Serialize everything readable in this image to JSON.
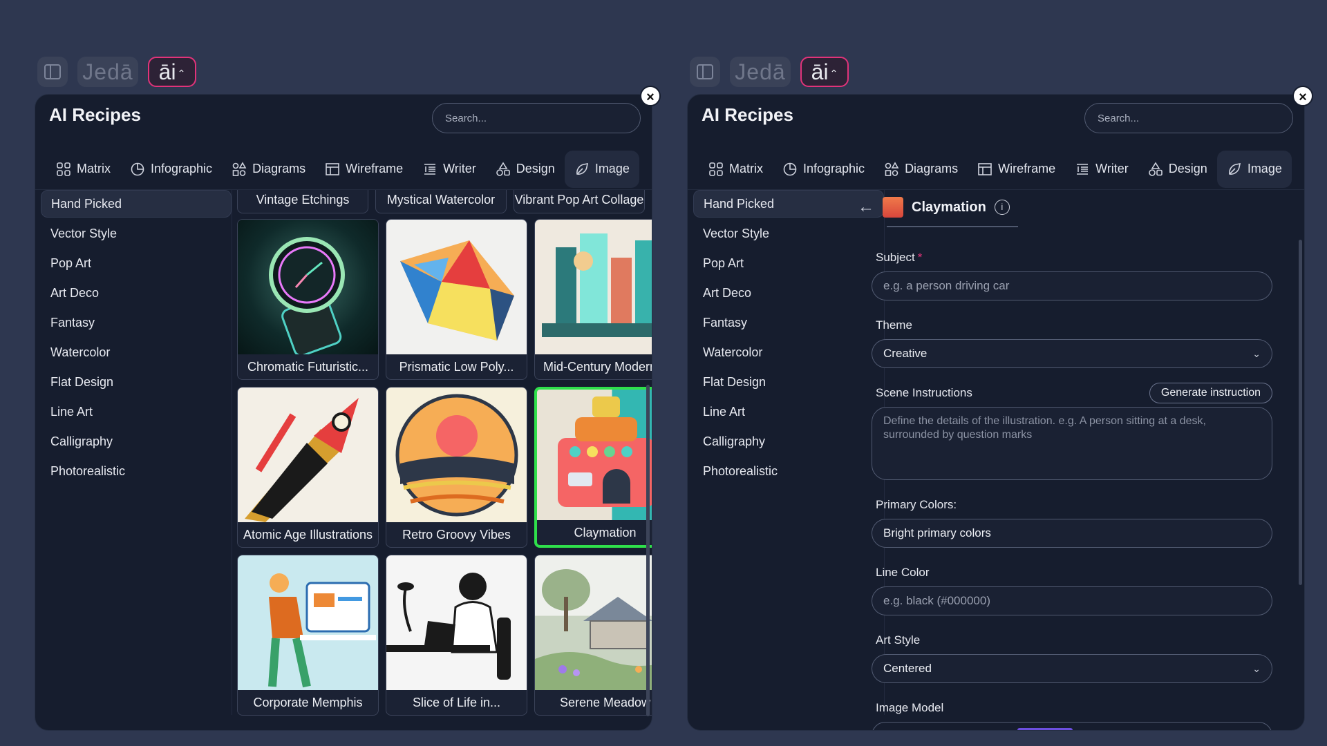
{
  "topbar": {
    "logo": "Jedā",
    "ai_label": "āi",
    "ai_chevron": "⌃"
  },
  "panel": {
    "title": "AI Recipes",
    "search_placeholder": "Search...",
    "tabs": [
      {
        "label": "Matrix",
        "icon": "matrix-icon"
      },
      {
        "label": "Infographic",
        "icon": "infographic-icon"
      },
      {
        "label": "Diagrams",
        "icon": "diagrams-icon"
      },
      {
        "label": "Wireframe",
        "icon": "wireframe-icon"
      },
      {
        "label": "Writer",
        "icon": "writer-icon"
      },
      {
        "label": "Design",
        "icon": "design-icon"
      },
      {
        "label": "Image",
        "icon": "image-icon"
      }
    ],
    "active_tab": "Image",
    "sidebar": [
      "Hand Picked",
      "Vector Style",
      "Pop Art",
      "Art Deco",
      "Fantasy",
      "Watercolor",
      "Flat Design",
      "Line Art",
      "Calligraphy",
      "Photorealistic"
    ],
    "active_sidebar": "Hand Picked"
  },
  "gallery": {
    "top_labels": [
      "Vintage Etchings",
      "Mystical Watercolor",
      "Vibrant Pop Art Collage"
    ],
    "cards": [
      {
        "label": "Chromatic Futuristic..."
      },
      {
        "label": "Prismatic Low Poly..."
      },
      {
        "label": "Mid-Century Modern..."
      },
      {
        "label": "Atomic Age Illustrations"
      },
      {
        "label": "Retro Groovy Vibes"
      },
      {
        "label": "Claymation",
        "selected": true
      },
      {
        "label": "Corporate Memphis"
      },
      {
        "label": "Slice of Life in..."
      },
      {
        "label": "Serene Meadow"
      }
    ]
  },
  "form": {
    "back": "←",
    "recipe_name": "Claymation",
    "info": "i",
    "subject_label": "Subject",
    "required_mark": "*",
    "subject_placeholder": "e.g. a person driving car",
    "theme_label": "Theme",
    "theme_value": "Creative",
    "scene_label": "Scene Instructions",
    "generate_label": "Generate instruction",
    "scene_placeholder": "Define the details of the illustration. e.g. A person sitting at a desk, surrounded by question marks",
    "primary_label": "Primary Colors:",
    "primary_value": "Bright primary colors",
    "line_label": "Line Color",
    "line_placeholder": "e.g. black (#000000)",
    "art_label": "Art Style",
    "art_value": "Centered",
    "model_label": "Image Model"
  },
  "colors": {
    "accent": "#e2337a",
    "selected_border": "#2fe04b",
    "panel_bg": "#161d2e",
    "page_bg": "#2e3750"
  }
}
